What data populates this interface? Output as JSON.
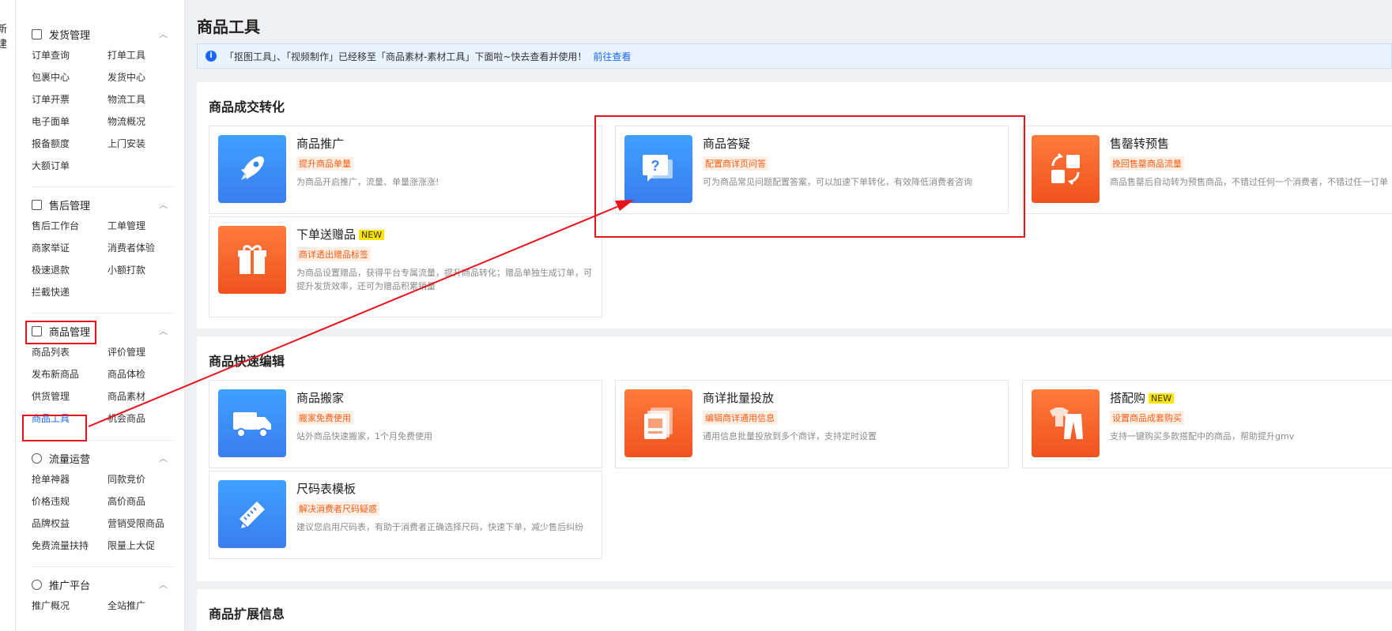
{
  "edge_text": "新建",
  "sidebar": {
    "sections": [
      {
        "title": "发货管理",
        "items": [
          "订单查询",
          "打单工具",
          "包裹中心",
          "发货中心",
          "订单开票",
          "物流工具",
          "电子面单",
          "物流概况",
          "报备额度",
          "上门安装",
          "大额订单"
        ]
      },
      {
        "title": "售后管理",
        "items": [
          "售后工作台",
          "工单管理",
          "商家举证",
          "消费者体验",
          "极速退款",
          "小额打款",
          "拦截快递"
        ]
      },
      {
        "title": "商品管理",
        "items": [
          "商品列表",
          "评价管理",
          "发布新商品",
          "商品体检",
          "供货管理",
          "商品素材",
          "商品工具",
          "机会商品"
        ]
      },
      {
        "title": "流量运营",
        "items": [
          "抢单神器",
          "同款竞价",
          "价格违规",
          "高价商品",
          "品牌权益",
          "营销受限商品",
          "免费流量扶持",
          "限量上大促"
        ]
      },
      {
        "title": "推广平台",
        "items": [
          "推广概况",
          "全站推广"
        ]
      }
    ],
    "active_item": "商品工具"
  },
  "main": {
    "title": "商品工具",
    "notice": {
      "text": "「抠图工具」、「视频制作」已经移至「商品素材-素材工具」下面啦~快去查看并使用！",
      "link": "前往查看"
    },
    "panels": [
      {
        "title": "商品成交转化",
        "cards": [
          {
            "title": "商品推广",
            "tag": "提升商品单量",
            "desc": "为商品开启推广，流量、单量涨涨涨!",
            "icon": "rocket-icon",
            "color": "blue"
          },
          {
            "title": "商品答疑",
            "tag": "配置商详页问答",
            "desc": "可为商品常见问题配置答案，可以加速下单转化，有效降低消费者咨询",
            "icon": "question-chat-icon",
            "color": "blue"
          },
          {
            "title": "售罄转预售",
            "tag": "挽回售罄商品流量",
            "desc": "商品售罄后自动转为预售商品，不错过任何一个消费者，不错过任一订单",
            "icon": "convert-icon",
            "color": "orange"
          },
          {
            "title": "下单送赠品",
            "badge": "NEW",
            "tag": "商详透出赠品标签",
            "desc": "为商品设置赠品，获得平台专属流量，提升商品转化；赠品单独生成订单，可提升发货效率，还可为赠品积累销量",
            "icon": "gift-icon",
            "color": "orange"
          }
        ]
      },
      {
        "title": "商品快速编辑",
        "cards": [
          {
            "title": "商品搬家",
            "tag": "搬家免费使用",
            "desc": "站外商品快速搬家，1个月免费使用",
            "icon": "truck-icon",
            "color": "blue"
          },
          {
            "title": "商详批量投放",
            "tag": "编辑商详通用信息",
            "desc": "通用信息批量投放到多个商详，支持定时设置",
            "icon": "image-stack-icon",
            "color": "orange"
          },
          {
            "title": "搭配购",
            "badge": "NEW",
            "tag": "设置商品成套购买",
            "desc": "支持一键购买多款搭配中的商品，帮助提升gmv",
            "icon": "outfit-icon",
            "color": "orange"
          },
          {
            "title": "尺码表模板",
            "tag": "解决消费者尺码疑惑",
            "desc": "建议您启用尺码表，有助于消费者正确选择尺码，快速下单，减少售后纠纷",
            "icon": "ruler-pencil-icon",
            "color": "blue"
          }
        ]
      },
      {
        "title": "商品扩展信息",
        "cards": []
      }
    ]
  },
  "colors": {
    "accent": "#1966ff",
    "highlight": "#e8121c",
    "tag_text": "#ff5a14"
  }
}
